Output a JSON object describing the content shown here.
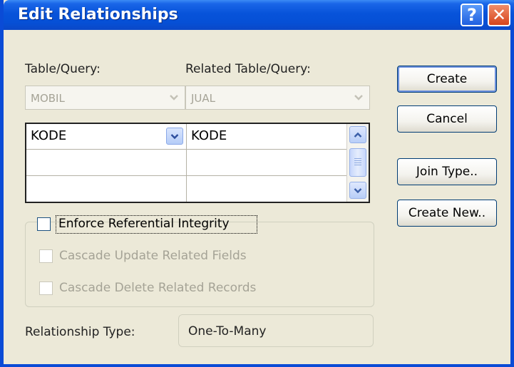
{
  "window": {
    "title": "Edit Relationships",
    "help_icon": "?",
    "close_icon": "✕"
  },
  "labels": {
    "table_query": "Table/Query:",
    "related_table_query": "Related Table/Query:",
    "relationship_type": "Relationship Type:"
  },
  "combos": {
    "table": {
      "value": "MOBIL",
      "enabled": false
    },
    "related_table": {
      "value": "JUAL",
      "enabled": false
    }
  },
  "fields_grid": {
    "rows": [
      {
        "left": "KODE",
        "right": "KODE"
      },
      {
        "left": "",
        "right": ""
      },
      {
        "left": "",
        "right": ""
      }
    ]
  },
  "options": {
    "enforce_integrity": {
      "label": "Enforce Referential Integrity",
      "checked": false,
      "enabled": true
    },
    "cascade_update": {
      "label": "Cascade Update Related Fields",
      "checked": false,
      "enabled": false
    },
    "cascade_delete": {
      "label": "Cascade Delete Related Records",
      "checked": false,
      "enabled": false
    }
  },
  "relationship_type": {
    "value": "One-To-Many"
  },
  "buttons": {
    "create": "Create",
    "cancel": "Cancel",
    "join_type": "Join Type..",
    "create_new": "Create New.."
  },
  "colors": {
    "titlebar": "#0753da",
    "dialog_bg": "#ece9d8",
    "disabled_text": "#a5a396"
  },
  "icons": {
    "combo_arrow": "chevron-down-icon",
    "scroll_up": "chevron-up-icon",
    "scroll_down": "chevron-down-icon"
  }
}
